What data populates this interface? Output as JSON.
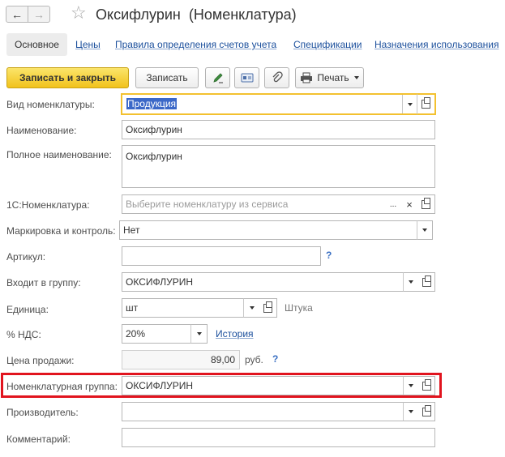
{
  "window": {
    "title": "Оксифлурин  (Номенклатура)",
    "back_icon": "←",
    "forward_icon": "→",
    "star_icon": "☆"
  },
  "tabs": [
    {
      "label": "Основное",
      "active": true
    },
    {
      "label": "Цены"
    },
    {
      "label": "Правила определения счетов учета"
    },
    {
      "label": "Спецификации"
    },
    {
      "label": "Назначения использования"
    }
  ],
  "toolbar": {
    "save_close_label": "Записать и закрыть",
    "save_label": "Записать",
    "print_label": "Печать"
  },
  "form": {
    "vid": {
      "label": "Вид номенклатуры:",
      "value": "Продукция"
    },
    "name": {
      "label": "Наименование:",
      "value": "Оксифлурин"
    },
    "full_name": {
      "label": "Полное наименование:",
      "value": "Оксифлурин"
    },
    "nomenclature_1c": {
      "label": "1С:Номенклатура:",
      "placeholder": "Выберите номенклатуру из сервиса",
      "dots": "...",
      "clear": "×"
    },
    "marking": {
      "label": "Маркировка и контроль:",
      "value": "Нет"
    },
    "article": {
      "label": "Артикул:",
      "value": "",
      "help": "?"
    },
    "group": {
      "label": "Входит в группу:",
      "value": "ОКСИФЛУРИН"
    },
    "unit": {
      "label": "Единица:",
      "value": "шт",
      "hint": "Штука"
    },
    "vat": {
      "label": "% НДС:",
      "value": "20%",
      "history_link": "История"
    },
    "price": {
      "label": "Цена продажи:",
      "value": "89,00",
      "currency": "руб.",
      "help": "?"
    },
    "nom_group": {
      "label": "Номенклатурная группа:",
      "value": "ОКСИФЛУРИН"
    },
    "producer": {
      "label": "Производитель:",
      "value": ""
    },
    "comment": {
      "label": "Комментарий:",
      "value": ""
    }
  },
  "colors": {
    "accent_yellow": "#f1c21b",
    "focus_border": "#f3c12f",
    "highlight_red": "#e1141e",
    "link_blue": "#1b4f9c",
    "selection_blue": "#3b68c8"
  }
}
